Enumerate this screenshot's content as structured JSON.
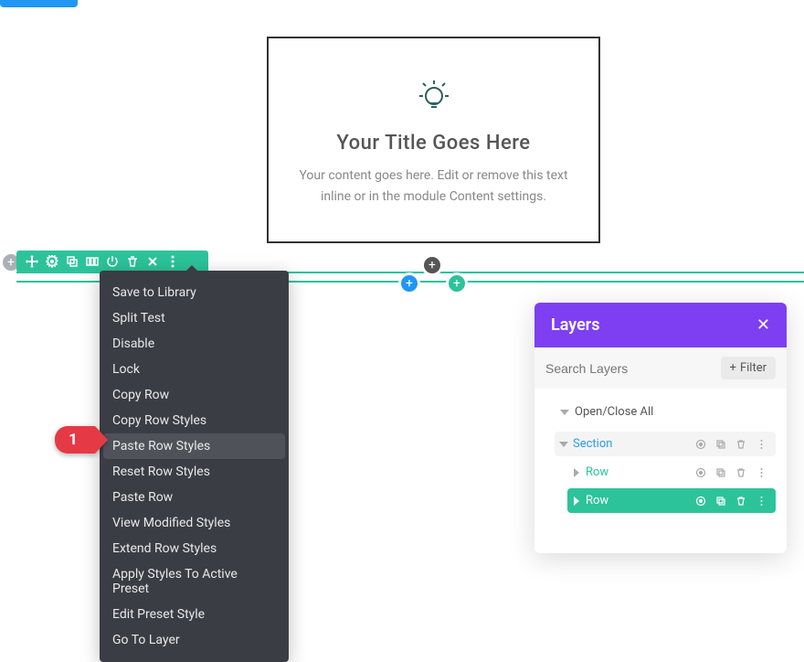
{
  "module": {
    "title": "Your Title Goes Here",
    "text": "Your content goes here. Edit or remove this text inline or in the module Content settings."
  },
  "toolbar_icons": [
    "move",
    "settings",
    "duplicate",
    "columns",
    "power",
    "trash",
    "close",
    "more"
  ],
  "context_menu": {
    "items": [
      "Save to Library",
      "Split Test",
      "Disable",
      "Lock",
      "Copy Row",
      "Copy Row Styles",
      "Paste Row Styles",
      "Reset Row Styles",
      "Paste Row",
      "View Modified Styles",
      "Extend Row Styles",
      "Apply Styles To Active Preset",
      "Edit Preset Style",
      "Go To Layer"
    ],
    "highlighted_index": 6
  },
  "marker": {
    "number": "1"
  },
  "layers": {
    "title": "Layers",
    "search_placeholder": "Search Layers",
    "filter_label": "Filter",
    "open_close_label": "Open/Close All",
    "tree": {
      "section_label": "Section",
      "row1_label": "Row",
      "row2_label": "Row"
    }
  },
  "colors": {
    "accent_green": "#2cc39b",
    "accent_purple": "#7e3ff2",
    "accent_blue": "#2196f3",
    "marker_red": "#e63946"
  }
}
